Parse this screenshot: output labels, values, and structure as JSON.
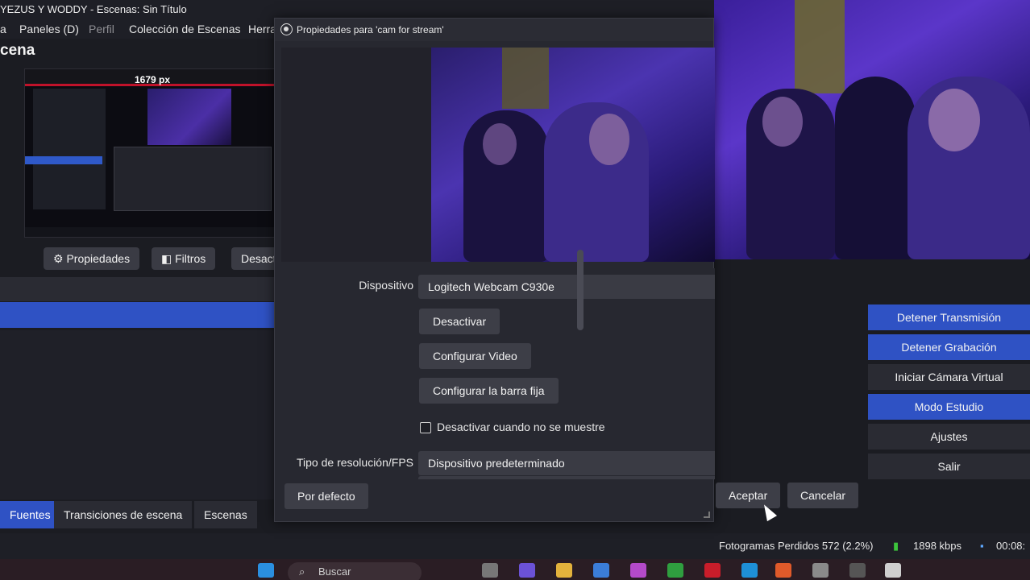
{
  "window": {
    "title": "YEZUS Y WODDY - Escenas: Sin Título"
  },
  "menu": {
    "items": [
      "a",
      "Paneles (D)",
      "Perfil",
      "Colección de Escenas",
      "Herra"
    ]
  },
  "scene_heading": "cena",
  "preview": {
    "size_label": "1679 px"
  },
  "toolbar": {
    "properties": "Propiedades",
    "filters": "Filtros",
    "deactivate": "Desacti"
  },
  "dock_tabs": [
    "Fuentes",
    "Transiciones de escena",
    "Escenas"
  ],
  "controls": {
    "stop_stream": "Detener Transmisión",
    "stop_record": "Detener Grabación",
    "virtual_cam": "Iniciar Cámara Virtual",
    "studio_mode": "Modo Estudio",
    "settings": "Ajustes",
    "exit": "Salir"
  },
  "status": {
    "dropped_frames": "Fotogramas Perdidos 572 (2.2%)",
    "bitrate": "1898 kbps",
    "time": "00:08:"
  },
  "taskbar": {
    "search_placeholder": "Buscar"
  },
  "dialog": {
    "title": "Propiedades para 'cam for stream'",
    "device_label": "Dispositivo",
    "device_value": "Logitech Webcam C930e",
    "btn_deactivate": "Desactivar",
    "btn_config_video": "Configurar Video",
    "btn_config_bar": "Configurar la barra fija",
    "checkbox_label": "Desactivar cuando no se muestre",
    "resolution_label": "Tipo de resolución/FPS",
    "resolution_value": "Dispositivo predeterminado",
    "btn_defaults": "Por defecto",
    "btn_accept": "Aceptar",
    "btn_cancel": "Cancelar"
  },
  "colors": {
    "accent_blue": "#2f52c4",
    "dialog_bg": "#272830",
    "button_bg": "#3d3e47"
  }
}
